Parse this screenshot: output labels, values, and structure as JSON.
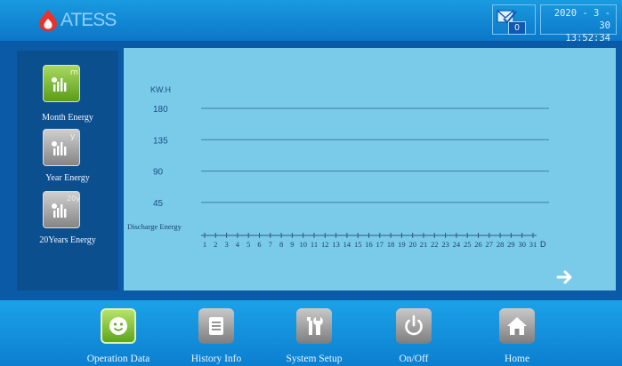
{
  "header": {
    "brand": "ATESS",
    "message_count": "0",
    "date": "2020 - 3 - 30",
    "time": "13:52:34"
  },
  "sidebar": {
    "items": [
      {
        "label": "Month Energy",
        "badge": "m",
        "active": true
      },
      {
        "label": "Year Energy",
        "badge": "y",
        "active": false
      },
      {
        "label": "20Years Energy",
        "badge": "20y",
        "active": false
      }
    ]
  },
  "chart_data": {
    "type": "bar",
    "ylabel": "KW.H",
    "xlabel": "D",
    "series_label": "Discharge Energy",
    "yticks": [
      180,
      135,
      90,
      45
    ],
    "categories": [
      "1",
      "2",
      "3",
      "4",
      "5",
      "6",
      "7",
      "8",
      "9",
      "10",
      "11",
      "12",
      "13",
      "14",
      "15",
      "16",
      "17",
      "18",
      "19",
      "20",
      "21",
      "22",
      "23",
      "24",
      "25",
      "26",
      "27",
      "28",
      "29",
      "30",
      "31"
    ],
    "values": [],
    "grid": true
  },
  "footer": {
    "items": [
      {
        "label": "Operation Data",
        "icon": "smiley-icon",
        "active": true
      },
      {
        "label": "History Info",
        "icon": "document-icon",
        "active": false
      },
      {
        "label": "System Setup",
        "icon": "tools-icon",
        "active": false
      },
      {
        "label": "On/Off",
        "icon": "power-icon",
        "active": false
      },
      {
        "label": "Home",
        "icon": "home-icon",
        "active": false
      }
    ]
  },
  "colors": {
    "background": "#0a5aa8",
    "chart_bg": "#7acbe9",
    "active_button": "#7bbf2c",
    "inactive_button": "#8e8e8e"
  }
}
